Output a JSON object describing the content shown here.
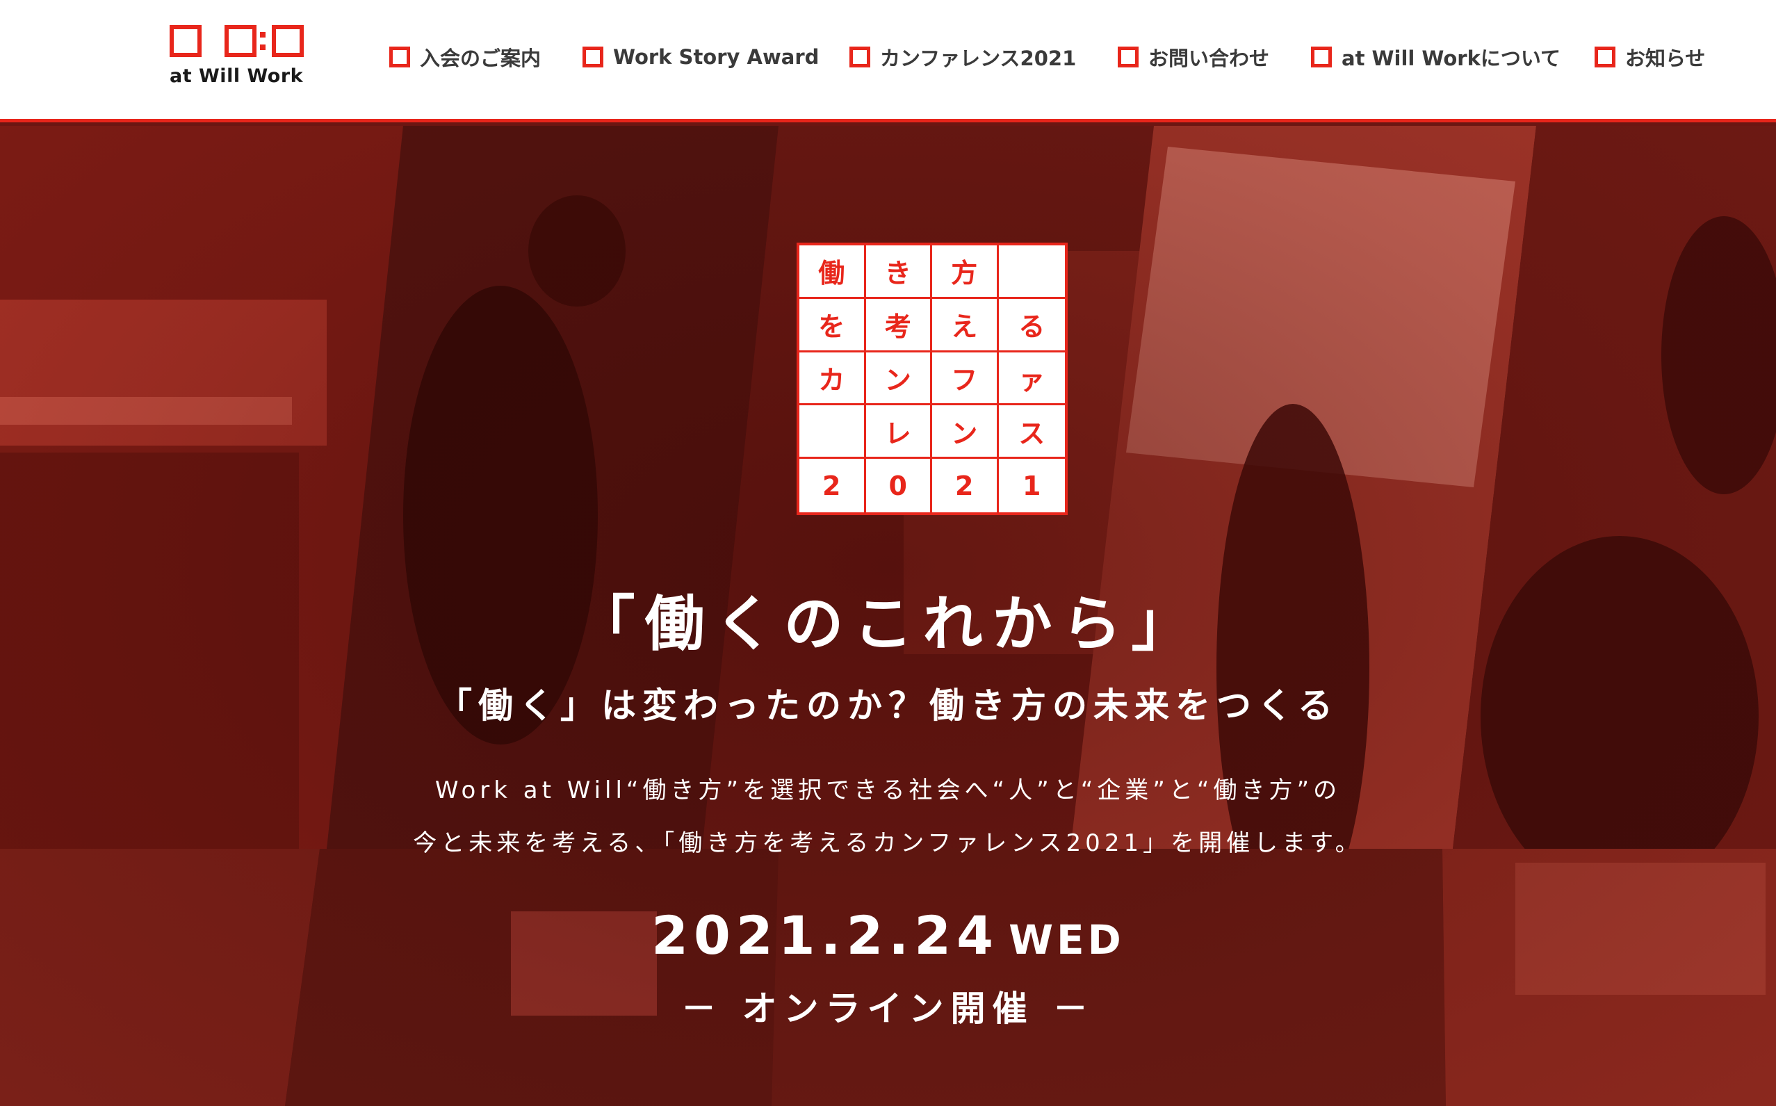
{
  "header": {
    "logo_text": "at Will Work",
    "nav": [
      {
        "label": "入会のご案内"
      },
      {
        "label": "Work Story Award"
      },
      {
        "label": "カンファレンス2021"
      },
      {
        "label": "お問い合わせ"
      },
      {
        "label": "at Will Workについて"
      },
      {
        "label": "お知らせ"
      }
    ]
  },
  "hero": {
    "grid_logo": [
      [
        "働",
        "き",
        "方",
        ""
      ],
      [
        "を",
        "考",
        "え",
        "る"
      ],
      [
        "カ",
        "ン",
        "フ",
        "ァ"
      ],
      [
        "",
        "レ",
        "ン",
        "ス"
      ],
      [
        "2",
        "0",
        "2",
        "1"
      ]
    ],
    "headline": "「働くのこれから」",
    "subheadline": "「働く」は変わったのか？働き方の未来をつくる",
    "description_line1": "Work at Will“働き方”を選択できる社会へ“人”と“企業”と“働き方”の",
    "description_line2": "今と未来を考える、「働き方を考えるカンファレンス2021」を開催します。",
    "date": "2021.2.24",
    "weekday": "WED",
    "venue": "－ オンライン開催 －"
  },
  "colors": {
    "accent": "#e8261b",
    "header_bg": "#ffffff",
    "hero_tint": "#8a1f18",
    "text_on_hero": "#ffffff"
  }
}
